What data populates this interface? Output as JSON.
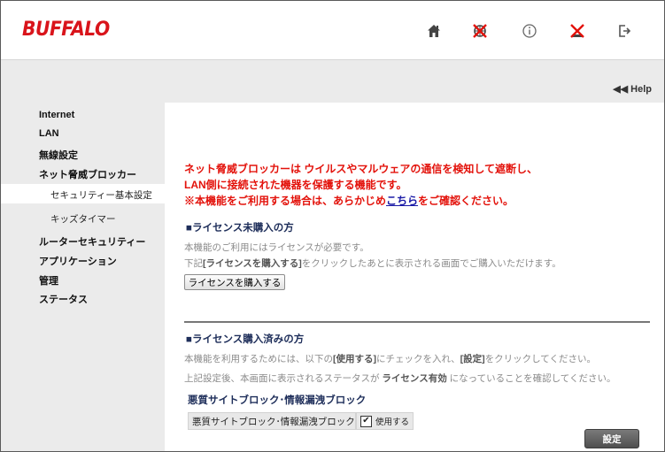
{
  "brand": {
    "logo_text": "BUFFALO",
    "color": "#d9141b"
  },
  "header_icons": [
    "home-icon",
    "no-internet-icon",
    "info-icon",
    "no-wireless-icon",
    "logout-icon"
  ],
  "help": {
    "label": "◀◀ Help"
  },
  "sidebar": {
    "items": [
      {
        "label": "Internet"
      },
      {
        "label": "LAN"
      },
      {
        "label": "無線設定"
      },
      {
        "label": "ネット脅威ブロッカー"
      },
      {
        "label": "セキュリティー基本設定",
        "active": true
      },
      {
        "label": "キッズタイマー"
      },
      {
        "label": "ルーターセキュリティー"
      },
      {
        "label": "アプリケーション"
      },
      {
        "label": "管理"
      },
      {
        "label": "ステータス"
      }
    ]
  },
  "main": {
    "notice_line1": "ネット脅威ブロッカーは ウイルスやマルウェアの通信を検知して遮断し、",
    "notice_line2": "LAN側に接続された機器を保護する機能です。",
    "notice_line3_pre": "※本機能をご利用する場合は、あらかじめ",
    "notice_line3_link": "こちら",
    "notice_line3_post": "をご確認ください。",
    "unpurchased": {
      "title": "■ライセンス未購入の方",
      "desc1": "本機能のご利用にはライセンスが必要です。",
      "desc2_pre": "下記",
      "desc2_bold": "[ライセンスを購入する]",
      "desc2_post": "をクリックしたあとに表示される画面でご購入いただけます。",
      "button": "ライセンスを購入する"
    },
    "purchased": {
      "title": "■ライセンス購入済みの方",
      "desc1_pre": "本機能を利用するためには、以下の",
      "desc1_b1": "[使用する]",
      "desc1_mid": "にチェックを入れ、",
      "desc1_b2": "[設定]",
      "desc1_post": "をクリックしてください。",
      "desc2_pre": "上記設定後、本画面に表示されるステータスが",
      "desc2_bold": " ライセンス有効 ",
      "desc2_post": "になっていることを確認してください。",
      "subtitle": "悪質サイトブロック･情報漏洩ブロック",
      "row_label": "悪質サイトブロック･情報漏洩ブロック",
      "checkbox_label": "使用する",
      "checkbox_checked": true,
      "set_button": "設定"
    }
  }
}
